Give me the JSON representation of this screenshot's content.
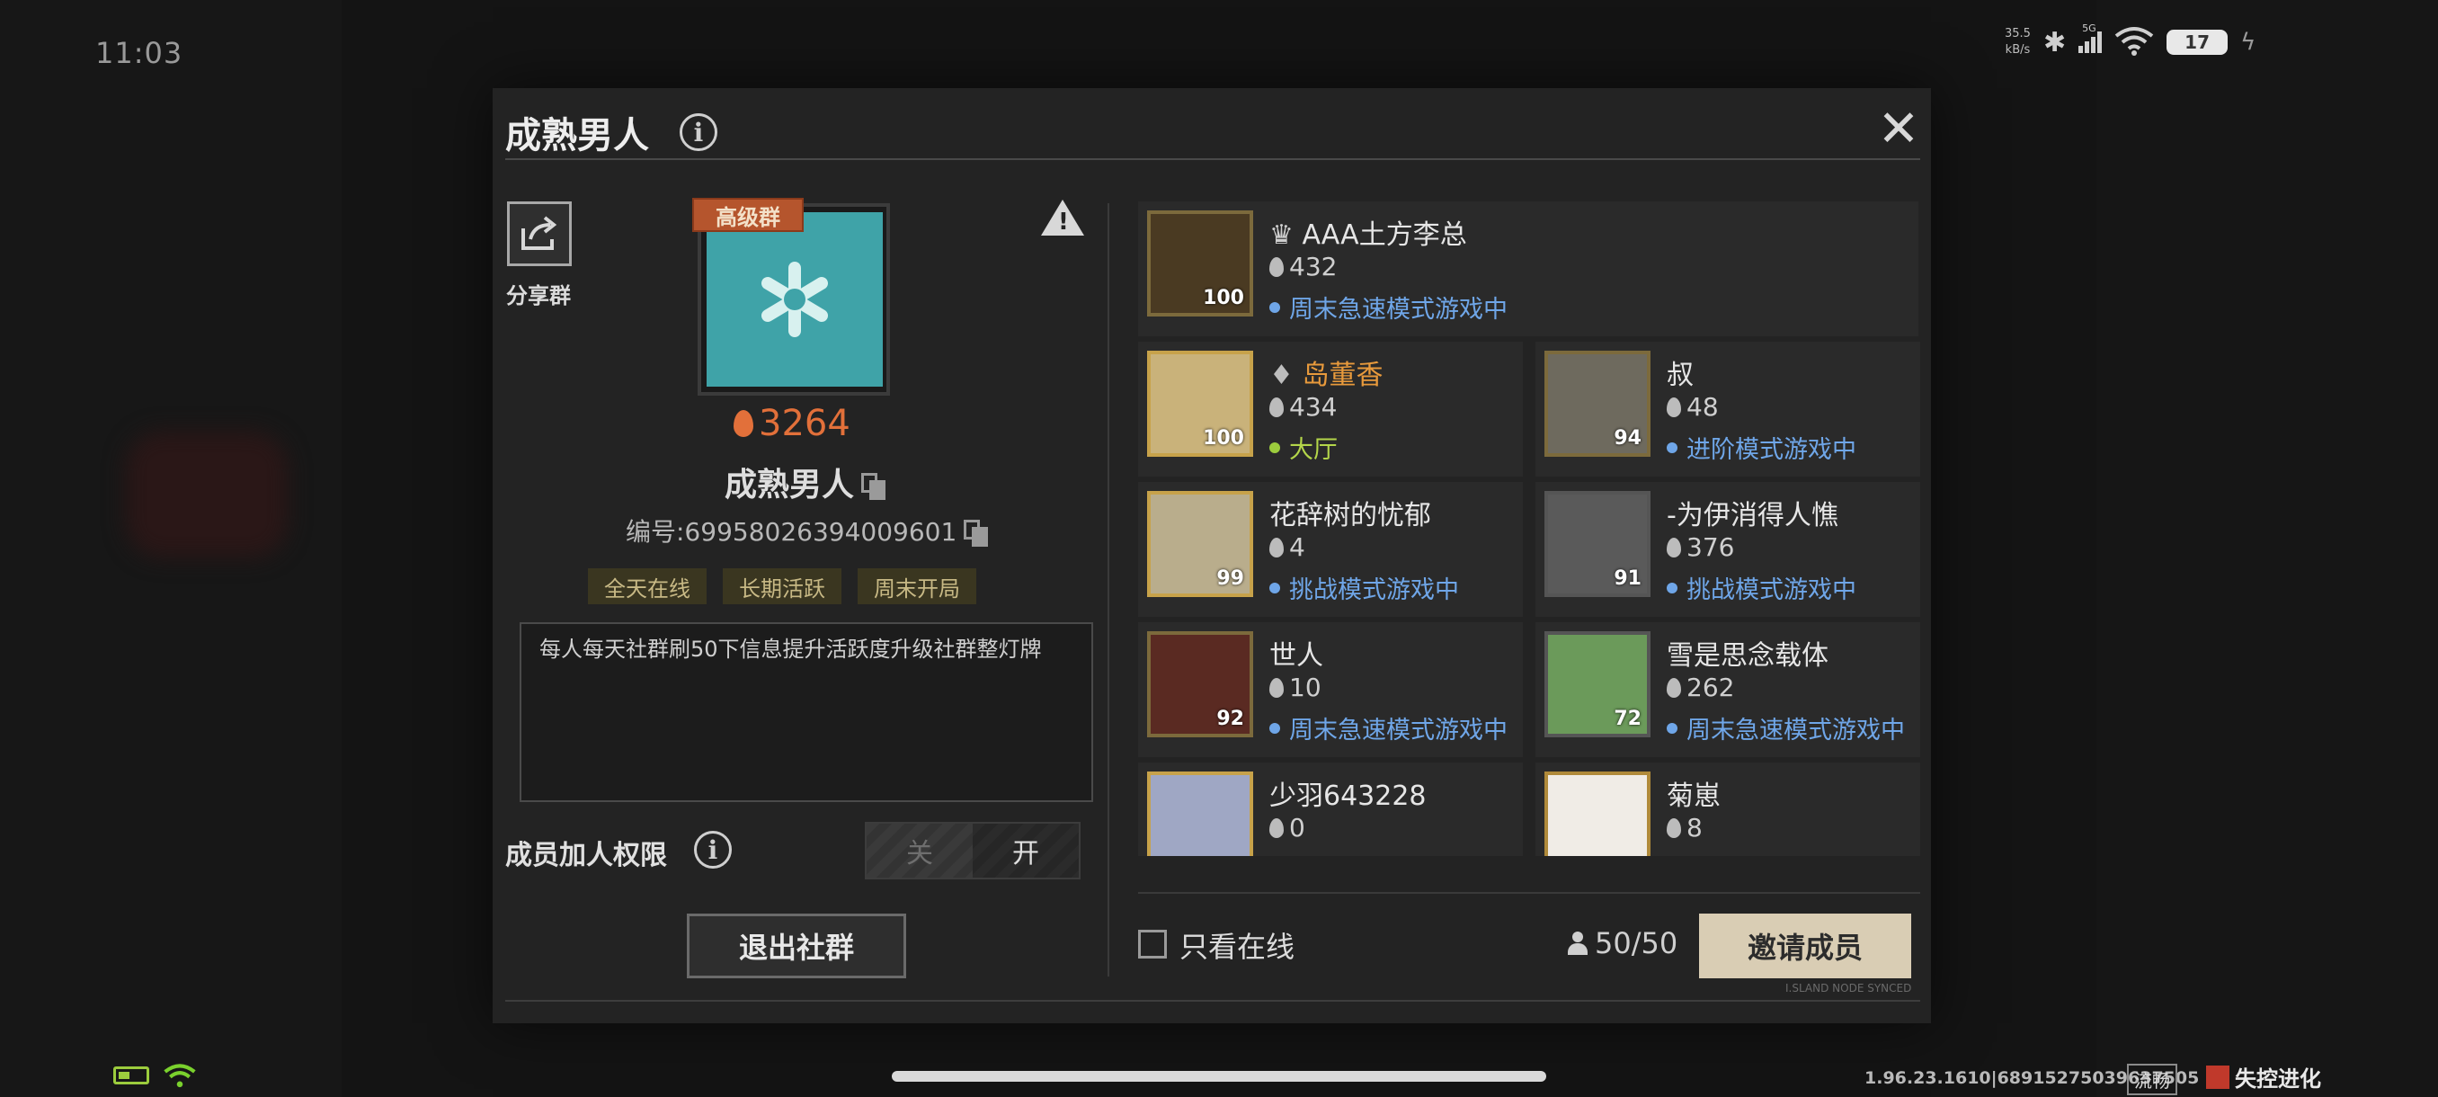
{
  "status_bar": {
    "time": "11:03",
    "net_speed_value": "35.5",
    "net_speed_unit": "kB/s",
    "signal": "5G",
    "battery": "17"
  },
  "dialog": {
    "title": "成熟男人",
    "share_label": "分享群",
    "tier_badge": "高级群",
    "heat": "3264",
    "group_name": "成熟男人",
    "group_id": "编号:69958026394009601",
    "tags": [
      "全天在线",
      "长期活跃",
      "周末开局"
    ],
    "description": "每人每天社群刷50下信息提升活跃度升级社群整灯牌",
    "permission_label": "成员加人权限",
    "toggle_off": "关",
    "toggle_on": "开",
    "leave_button": "退出社群",
    "online_only_label": "只看在线",
    "member_count": "50/50",
    "invite_button": "邀请成员",
    "sync_text": "I.SLAND NODE SYNCED"
  },
  "members": [
    {
      "name": "AAA土方李总",
      "heat": "432",
      "status": "周末急速模式游戏中",
      "level": "100"
    },
    {
      "name": "岛董香",
      "heat": "434",
      "status": "大厅",
      "level": "100"
    },
    {
      "name": "叔",
      "heat": "48",
      "status": "进阶模式游戏中",
      "level": "94"
    },
    {
      "name": "花辞树的忧郁",
      "heat": "4",
      "status": "挑战模式游戏中",
      "level": "99"
    },
    {
      "name": "-为伊消得人憔",
      "heat": "376",
      "status": "挑战模式游戏中",
      "level": "91"
    },
    {
      "name": "世人",
      "heat": "10",
      "status": "周末急速模式游戏中",
      "level": "92"
    },
    {
      "name": "雪是思念载体",
      "heat": "262",
      "status": "周末急速模式游戏中",
      "level": "72"
    },
    {
      "name": "少羽643228",
      "heat": "0",
      "status": "",
      "level": ""
    },
    {
      "name": "菊崽",
      "heat": "8",
      "status": "",
      "level": ""
    }
  ],
  "footer": {
    "build_info": "1.96.23.1610|68915275039637505",
    "smooth_label": "流畅",
    "game_logo": "失控进化"
  },
  "colors": {
    "accent_orange": "#e2703a",
    "status_blue": "#6fa6e8",
    "status_green": "#b4d64a",
    "invite_button_bg": "#d9cdb4"
  }
}
